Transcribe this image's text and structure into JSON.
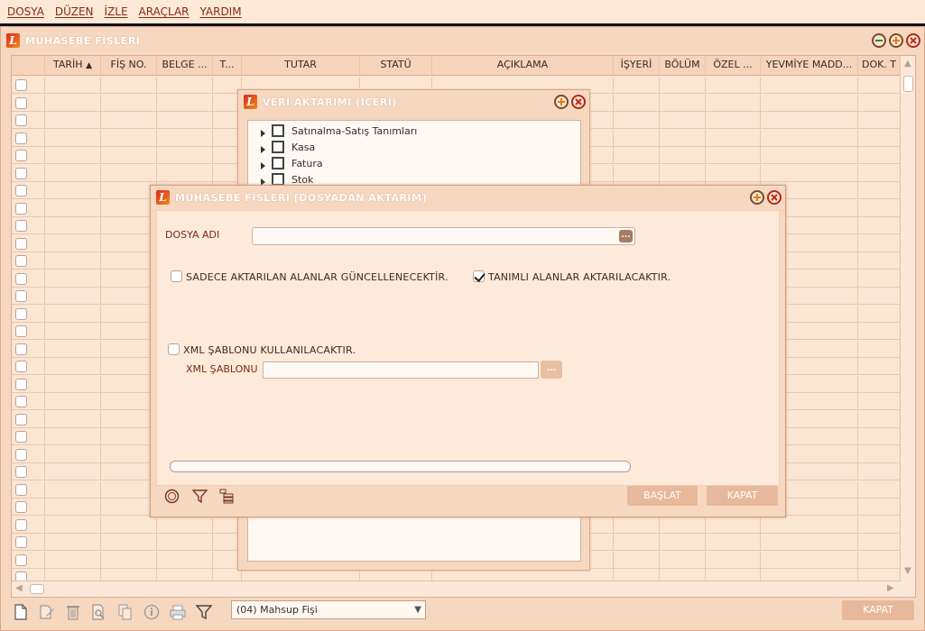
{
  "menu": [
    {
      "label": "DOSYA"
    },
    {
      "label": "DÜZEN"
    },
    {
      "label": "İZLE"
    },
    {
      "label": "ARAÇLAR"
    },
    {
      "label": "YARDIM"
    }
  ],
  "main_window": {
    "title": "MUHASEBE FİŞLERİ",
    "logo": "L",
    "columns": [
      "TARİH",
      "FİŞ NO.",
      "BELGE ...",
      "T...",
      "TUTAR",
      "STATÜ",
      "AÇIKLAMA",
      "İŞYERİ",
      "BÖLÜM",
      "ÖZEL ...",
      "YEVMİYE MADD...",
      "DOK. T"
    ],
    "fiche_type_combo": "(04) Mahsup Fişi",
    "close_label": "KAPAT"
  },
  "transfer_dialog": {
    "title": "VERİ AKTARIMI (İÇERİ)",
    "tree_items": [
      "Satınalma-Satış Tanımları",
      "Kasa",
      "Fatura",
      "Stok"
    ]
  },
  "file_dialog": {
    "title": "MUHASEBE FİŞLERİ [DOSYADAN AKTARIM]",
    "file_name_label": "DOSYA ADI",
    "file_name_value": "",
    "only_transferred_label": "SADECE AKTARILAN ALANLAR GÜNCELLENECEKTİR.",
    "only_transferred_checked": false,
    "defined_fields_label": "TANIMLI ALANLAR AKTARILACAKTIR.",
    "defined_fields_checked": true,
    "xml_template_check_label": "XML ŞABLONU KULLANILACAKTIR.",
    "xml_template_checked": false,
    "xml_template_label": "XML ŞABLONU",
    "xml_template_value": "",
    "browse_label": "...",
    "progress": 0,
    "start_label": "BAŞLAT",
    "close_label": "KAPAT"
  },
  "icons": {
    "bottom_toolbar": [
      "new-document-icon",
      "edit-icon",
      "delete-icon",
      "preview-icon",
      "copy-icon",
      "info-icon",
      "print-icon",
      "filter-icon"
    ],
    "file_dialog_toolbar": [
      "record-icon",
      "filter-icon",
      "list-icon"
    ]
  },
  "colors": {
    "background": "#f9e0cb",
    "accent_text": "#7a2a18",
    "button": "#e8b89a"
  }
}
